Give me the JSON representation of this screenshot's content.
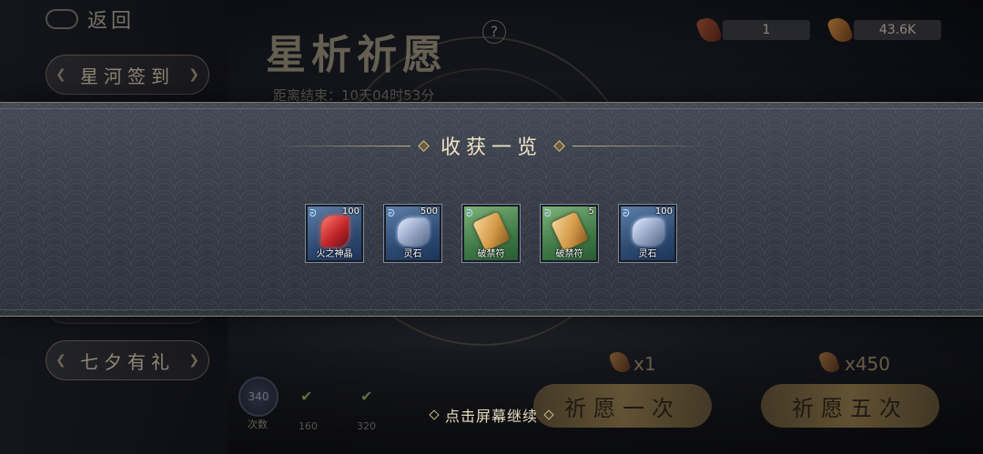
{
  "background": {
    "back_label": "返回",
    "side_tabs": [
      "星河签到",
      "七夕有礼"
    ],
    "event_title": "星析祈愿",
    "help_glyph": "?",
    "countdown": "距离结束：10天04时53分",
    "currencies": [
      {
        "icon": "red-gem-icon",
        "value": "1"
      },
      {
        "icon": "orange-gem-icon",
        "value": "43.6K"
      }
    ],
    "pray_once": {
      "label": "祈愿一次",
      "cost": "x1"
    },
    "pray_five": {
      "label": "祈愿五次",
      "cost": "x450"
    },
    "progress": {
      "value": "340",
      "label": "次数",
      "milestones": [
        "160",
        "320"
      ]
    }
  },
  "modal": {
    "title": "收获一览",
    "items": [
      {
        "name": "火之神晶",
        "count": "100",
        "rarity": "blue",
        "icon": "fire-crystal-icon"
      },
      {
        "name": "灵石",
        "count": "500",
        "rarity": "blue",
        "icon": "spirit-stone-icon"
      },
      {
        "name": "破禁符",
        "count": "",
        "rarity": "green",
        "icon": "talisman-icon"
      },
      {
        "name": "破禁符",
        "count": "5",
        "rarity": "green",
        "icon": "talisman-icon"
      },
      {
        "name": "灵石",
        "count": "100",
        "rarity": "blue",
        "icon": "spirit-stone-icon"
      }
    ]
  },
  "continue_label": "点击屏幕继续",
  "colors": {
    "gold": "#c9b27a",
    "banner": "#3b414d",
    "blue_frame": "#2d4a72",
    "green_frame": "#3f7a48"
  }
}
